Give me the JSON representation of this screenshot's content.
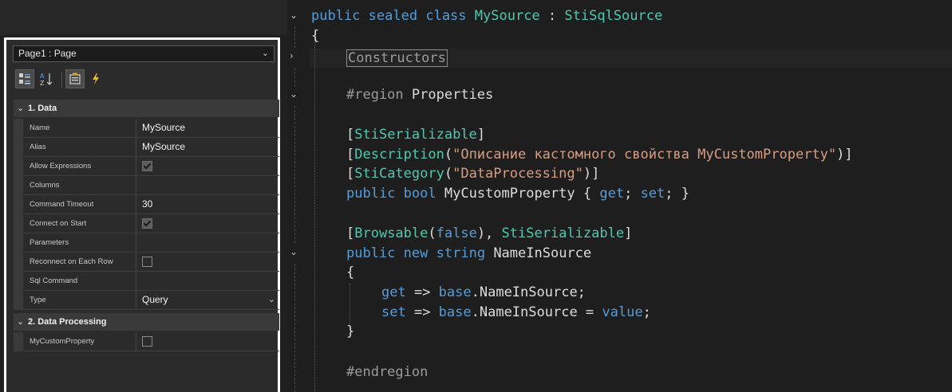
{
  "property_panel": {
    "page_selector": "Page1 : Page",
    "categories": [
      {
        "label": "1. Data",
        "properties": [
          {
            "name": "Name",
            "value": "MySource",
            "type": "text"
          },
          {
            "name": "Alias",
            "value": "MySource",
            "type": "text"
          },
          {
            "name": "Allow Expressions",
            "value": "",
            "type": "checkbox",
            "checked": true
          },
          {
            "name": "Columns",
            "value": "",
            "type": "text"
          },
          {
            "name": "Command Timeout",
            "value": "30",
            "type": "text"
          },
          {
            "name": "Connect on Start",
            "value": "",
            "type": "checkbox",
            "checked": true
          },
          {
            "name": "Parameters",
            "value": "",
            "type": "text"
          },
          {
            "name": "Reconnect on Each Row",
            "value": "",
            "type": "checkbox",
            "checked": false
          },
          {
            "name": "Sql Command",
            "value": "",
            "type": "text"
          },
          {
            "name": "Type",
            "value": "Query",
            "type": "dropdown"
          }
        ]
      },
      {
        "label": "2. Data Processing",
        "properties": [
          {
            "name": "MyCustomProperty",
            "value": "",
            "type": "checkbox",
            "checked": false
          }
        ]
      }
    ],
    "toolbar_icons": [
      "categorized-icon",
      "alphabetical-sort-icon",
      "properties-icon",
      "events-lightning-icon"
    ]
  },
  "code": {
    "class_decl": {
      "kw1": "public",
      "kw2": "sealed",
      "kw3": "class",
      "name": "MySource",
      "colon": " : ",
      "base": "StiSqlSource"
    },
    "open_brace": "{",
    "collapsed_region": "Constructors",
    "region_directive": "#region",
    "region_name": "Properties",
    "attr1": {
      "open": "[",
      "name": "StiSerializable",
      "close": "]"
    },
    "attr2": {
      "open": "[",
      "name": "Description",
      "paren_open": "(",
      "arg": "\"Описание кастомного свойства MyCustomProperty\"",
      "paren_close": ")]"
    },
    "attr3": {
      "open": "[",
      "name": "StiCategory",
      "paren_open": "(",
      "arg": "\"DataProcessing\"",
      "paren_close": ")]"
    },
    "prop1": {
      "kw1": "public",
      "kw2": "bool",
      "name": "MyCustomProperty",
      "brace_open": " { ",
      "get": "get",
      "semi1": "; ",
      "set": "set",
      "semi2": "; }"
    },
    "attr4": {
      "open": "[",
      "name": "Browsable",
      "paren_open": "(",
      "arg": "false",
      "mid": "), ",
      "name2": "StiSerializable",
      "close": "]"
    },
    "prop2": {
      "kw1": "public",
      "kw2": "new",
      "kw3": "string",
      "name": "NameInSource"
    },
    "prop2_open": "{",
    "getter": {
      "kw": "get",
      "arrow": " => ",
      "base": "base",
      "rest": ".NameInSource;"
    },
    "setter": {
      "kw": "set",
      "arrow": " => ",
      "base": "base",
      "mid": ".NameInSource = ",
      "value": "value",
      "end": ";"
    },
    "prop2_close": "}",
    "endregion": "#endregion"
  },
  "colors": {
    "keyword": "#569cd6",
    "type": "#4ec9b0",
    "string": "#d69d85",
    "preprocessor": "#9b9b9b",
    "panel_border": "#ffffff"
  }
}
